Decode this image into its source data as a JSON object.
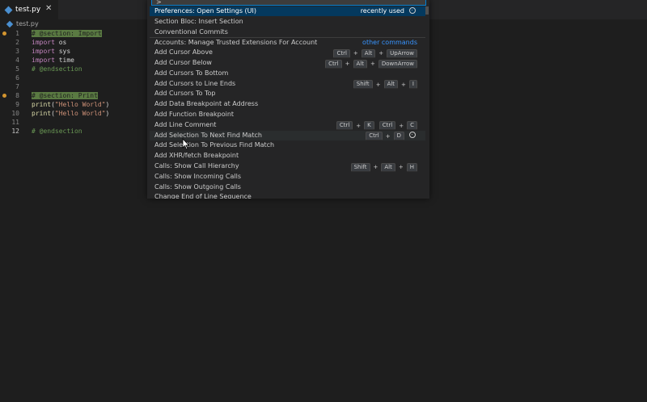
{
  "tab": {
    "filename": "test.py",
    "close": "✕"
  },
  "breadcrumb": {
    "filename": "test.py"
  },
  "code_lines": [
    {
      "n": "1",
      "parts": [
        {
          "t": "# @section: Import",
          "c": "hl"
        }
      ]
    },
    {
      "n": "2",
      "parts": [
        {
          "t": "import",
          "c": "kw"
        },
        {
          "t": " os",
          "c": "plain"
        }
      ]
    },
    {
      "n": "3",
      "parts": [
        {
          "t": "import",
          "c": "kw"
        },
        {
          "t": " sys",
          "c": "plain"
        }
      ]
    },
    {
      "n": "4",
      "parts": [
        {
          "t": "import",
          "c": "kw"
        },
        {
          "t": " time",
          "c": "plain"
        }
      ]
    },
    {
      "n": "5",
      "parts": [
        {
          "t": "# @endsection",
          "c": "cm"
        }
      ]
    },
    {
      "n": "6",
      "parts": []
    },
    {
      "n": "7",
      "parts": []
    },
    {
      "n": "8",
      "parts": [
        {
          "t": "# @section: Print",
          "c": "hl"
        }
      ]
    },
    {
      "n": "9",
      "parts": [
        {
          "t": "print",
          "c": "fn"
        },
        {
          "t": "(",
          "c": "plain"
        },
        {
          "t": "\"Hello World\"",
          "c": "str"
        },
        {
          "t": ")",
          "c": "plain"
        }
      ]
    },
    {
      "n": "10",
      "parts": [
        {
          "t": "print",
          "c": "fn"
        },
        {
          "t": "(",
          "c": "plain"
        },
        {
          "t": "\"Hello World\"",
          "c": "str"
        },
        {
          "t": ")",
          "c": "plain"
        }
      ]
    },
    {
      "n": "11",
      "parts": []
    },
    {
      "n": "12",
      "parts": [
        {
          "t": "# @endsection",
          "c": "cm"
        }
      ]
    }
  ],
  "current_line": "12",
  "palette": {
    "input_value": ">",
    "items": [
      {
        "label": "Preferences: Open Settings (UI)",
        "tag": "recently used",
        "gear": true,
        "state": "sel"
      },
      {
        "label": "Section Bloc: Insert Section"
      },
      {
        "label": "Conventional Commits"
      },
      {
        "label": "Accounts: Manage Trusted Extensions For Account",
        "tag_blue": "other commands",
        "sep": true
      },
      {
        "label": "Add Cursor Above",
        "keys": [
          "Ctrl",
          "Alt",
          "UpArrow"
        ]
      },
      {
        "label": "Add Cursor Below",
        "keys": [
          "Ctrl",
          "Alt",
          "DownArrow"
        ]
      },
      {
        "label": "Add Cursors To Bottom"
      },
      {
        "label": "Add Cursors to Line Ends",
        "keys": [
          "Shift",
          "Alt",
          "I"
        ]
      },
      {
        "label": "Add Cursors To Top"
      },
      {
        "label": "Add Data Breakpoint at Address"
      },
      {
        "label": "Add Function Breakpoint"
      },
      {
        "label": "Add Line Comment",
        "chords": [
          [
            "Ctrl",
            "K"
          ],
          [
            "Ctrl",
            "C"
          ]
        ]
      },
      {
        "label": "Add Selection To Next Find Match",
        "keys": [
          "Ctrl",
          "D"
        ],
        "gear": true,
        "state": "hov"
      },
      {
        "label": "Add Selection To Previous Find Match"
      },
      {
        "label": "Add XHR/fetch Breakpoint"
      },
      {
        "label": "Calls: Show Call Hierarchy",
        "keys": [
          "Shift",
          "Alt",
          "H"
        ]
      },
      {
        "label": "Calls: Show Incoming Calls"
      },
      {
        "label": "Calls: Show Outgoing Calls"
      },
      {
        "label": "Change End of Line Sequence"
      }
    ]
  }
}
